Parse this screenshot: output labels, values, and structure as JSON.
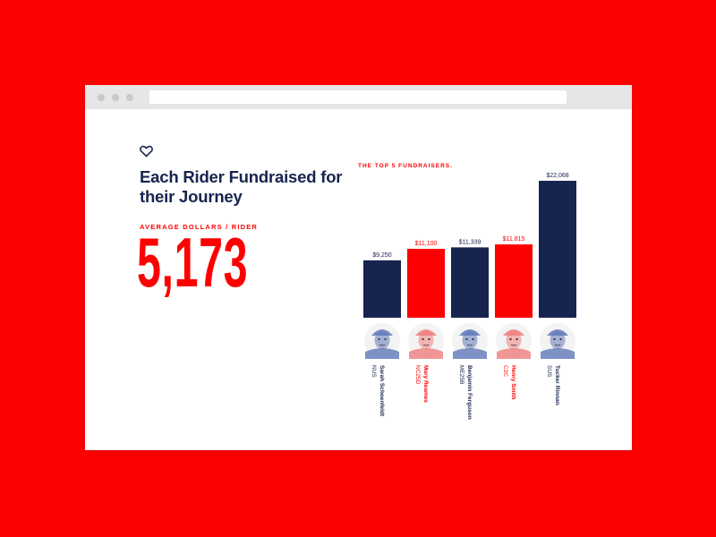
{
  "headline": "Each Rider Fundraised for their Journey",
  "average": {
    "label": "AVERAGE DOLLARS / RIDER",
    "value": "5,173"
  },
  "icons": {
    "heart": "heart-icon"
  },
  "colors": {
    "background": "#fd0000",
    "navy": "#17244f",
    "red": "#fd0000",
    "navy_photo": "#5b73b5",
    "red_photo": "#f08a8a"
  },
  "chart_data": {
    "type": "bar",
    "title": "THE TOP 5 FUNDRAISERS.",
    "categories": [
      "Sarah Schoenfeldt",
      "Mary Reames",
      "Benjamin Ferguson",
      "Henry Smith",
      "Tucker Rinnan"
    ],
    "subcategories": [
      "NUS",
      "NC25D",
      "ME25B",
      "C2C",
      "SUS"
    ],
    "values": [
      9250,
      11100,
      11339,
      11815,
      22068
    ],
    "value_labels": [
      "$9,250",
      "$11,100",
      "$11,339",
      "$11,815",
      "$22,068"
    ],
    "bar_colors": [
      "#17244f",
      "#fd0000",
      "#17244f",
      "#fd0000",
      "#17244f"
    ],
    "ylim": [
      0,
      22068
    ],
    "grid": false,
    "xlabel": "",
    "ylabel": ""
  }
}
